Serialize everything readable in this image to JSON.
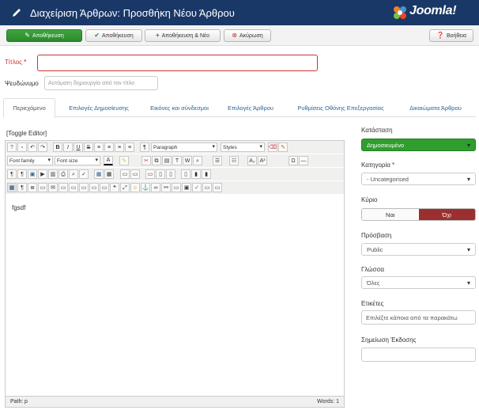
{
  "header": {
    "title": "Διαχείριση Άρθρων: Προσθήκη Νέου Άρθρου",
    "logo_text": "Joomla!"
  },
  "toolbar": {
    "save_label": "Αποθήκευση",
    "save_close_label": "Αποθήκευση",
    "save_new_label": "Αποθήκευση & Νέο",
    "cancel_label": "Ακύρωση",
    "help_label": "Βοήθεια"
  },
  "form": {
    "title_label": "Τίτλος",
    "title_required": "*",
    "title_value": "",
    "alias_label": "Ψευδώνυμο",
    "alias_placeholder": "Αυτόματη δημιουργία από τον τίτλο"
  },
  "tabs": [
    {
      "label": "Περιεχόμενο",
      "active": true
    },
    {
      "label": "Επιλογές Δημοσίευσης"
    },
    {
      "label": "Εικόνες και σύνδεσμοι"
    },
    {
      "label": "Επιλογές Άρθρου"
    },
    {
      "label": "Ρυθμίσεις Οθόνης Επεξεργασίας"
    },
    {
      "label": "Δικαιώματα Άρθρου"
    }
  ],
  "editor": {
    "toggle_label": "[Toggle Editor]",
    "format_select": "Paragraph",
    "styles_select": "Styles",
    "font_family_select": "Font family",
    "font_size_select": "Font size",
    "content": "fgsdf",
    "path_label": "Path:",
    "path_value": "p",
    "words_label": "Words: 1"
  },
  "sidebar": {
    "status_label": "Κατάσταση",
    "status_value": "Δημοσιευμένο",
    "category_label": "Κατηγορία",
    "category_required": "*",
    "category_value": "- Uncategorised",
    "featured_label": "Κύριο",
    "featured_yes": "Ναι",
    "featured_no": "Όχι",
    "access_label": "Πρόσβαση",
    "access_value": "Public",
    "language_label": "Γλώσσα",
    "language_value": "Όλες",
    "tags_label": "Ετικέτες",
    "tags_placeholder": "Επιλέξτε κάποια από τα παρακάτω",
    "version_note_label": "Σημείωση Έκδοσης",
    "version_note_value": ""
  },
  "colors": {
    "header_bg": "#1a3867",
    "save_green": "#2f9e2f",
    "featured_no_active": "#9b2f2f"
  }
}
